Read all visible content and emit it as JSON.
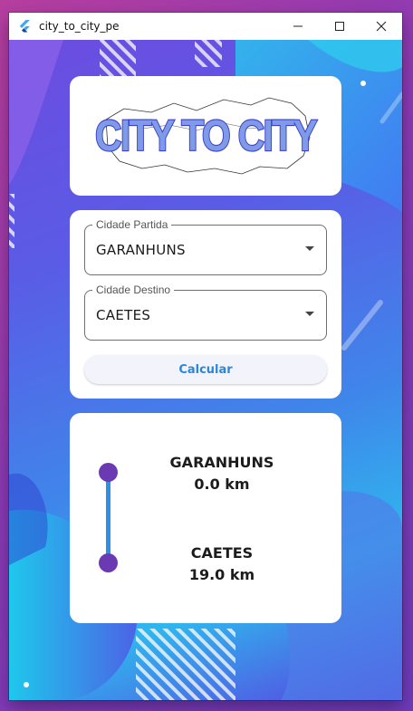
{
  "window": {
    "title": "city_to_city_pe"
  },
  "logo": {
    "text": "CITY TO CITY"
  },
  "form": {
    "origin": {
      "label": "Cidade Partida",
      "value": "GARANHUNS"
    },
    "destination": {
      "label": "Cidade Destino",
      "value": "CAETES"
    },
    "calculate_label": "Calcular"
  },
  "result": {
    "stops": [
      {
        "name": "GARANHUNS",
        "distance": "0.0 km"
      },
      {
        "name": "CAETES",
        "distance": "19.0 km"
      }
    ]
  },
  "icons": {
    "app": "flutter-icon",
    "minimize": "minimize-icon",
    "maximize": "maximize-icon",
    "close": "close-icon",
    "dropdown": "chevron-down-icon"
  },
  "colors": {
    "accent_blue": "#2e8fe3",
    "dot_purple": "#6b3ab3",
    "button_text": "#2d86d9"
  }
}
